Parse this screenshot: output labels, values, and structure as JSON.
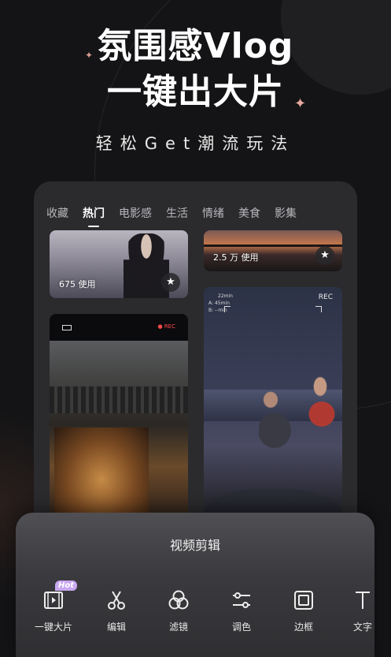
{
  "headline": {
    "line1": "氛围感Vlog",
    "line2": "一键出大片",
    "subline": "轻松Get潮流玩法"
  },
  "tabs": [
    {
      "label": "收藏",
      "active": false
    },
    {
      "label": "热门",
      "active": true
    },
    {
      "label": "电影感",
      "active": false
    },
    {
      "label": "生活",
      "active": false
    },
    {
      "label": "情绪",
      "active": false
    },
    {
      "label": "美食",
      "active": false
    },
    {
      "label": "影集",
      "active": false
    }
  ],
  "templates": [
    {
      "uses": "675 使用"
    },
    {
      "uses": "2.5 万 使用"
    },
    {
      "rec": "REC"
    },
    {
      "rec": "REC",
      "hud_top": "22min",
      "hud_a": "A: 45min",
      "hud_b": "B: --min"
    }
  ],
  "sheet": {
    "title": "视频剪辑",
    "tools": [
      {
        "label": "一键大片",
        "icon": "video-icon",
        "badge": "Hot"
      },
      {
        "label": "编辑",
        "icon": "scissors-icon"
      },
      {
        "label": "滤镜",
        "icon": "filter-icon"
      },
      {
        "label": "调色",
        "icon": "adjust-icon"
      },
      {
        "label": "边框",
        "icon": "frame-icon"
      },
      {
        "label": "文字",
        "icon": "text-icon"
      }
    ]
  },
  "colors": {
    "background": "#141416",
    "panel": "#2b2b2e",
    "hot_badge": "#c9a7f0",
    "sparkle": "#e8a9a0"
  }
}
